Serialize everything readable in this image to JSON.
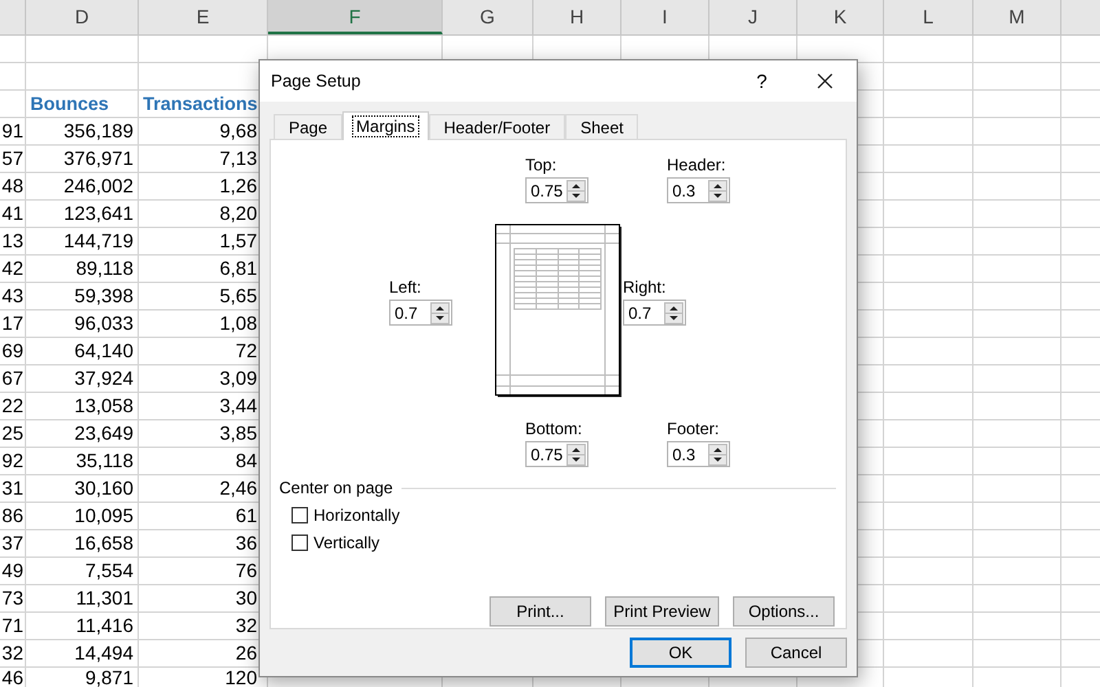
{
  "sheet": {
    "columns": [
      {
        "label": "D",
        "selected": false
      },
      {
        "label": "E",
        "selected": false
      },
      {
        "label": "F",
        "selected": true
      },
      {
        "label": "G",
        "selected": false
      },
      {
        "label": "H",
        "selected": false
      },
      {
        "label": "I",
        "selected": false
      },
      {
        "label": "J",
        "selected": false
      },
      {
        "label": "K",
        "selected": false
      },
      {
        "label": "L",
        "selected": false
      },
      {
        "label": "M",
        "selected": false
      }
    ],
    "header_row": {
      "bounces": "Bounces",
      "transactions": "Transactions"
    },
    "rows": [
      {
        "column_c": "91",
        "bounces": "356,189",
        "transactions": "9,68"
      },
      {
        "column_c": "57",
        "bounces": "376,971",
        "transactions": "7,13"
      },
      {
        "column_c": "48",
        "bounces": "246,002",
        "transactions": "1,26"
      },
      {
        "column_c": "41",
        "bounces": "123,641",
        "transactions": "8,20"
      },
      {
        "column_c": "13",
        "bounces": "144,719",
        "transactions": "1,57"
      },
      {
        "column_c": "42",
        "bounces": "89,118",
        "transactions": "6,81"
      },
      {
        "column_c": "43",
        "bounces": "59,398",
        "transactions": "5,65"
      },
      {
        "column_c": "17",
        "bounces": "96,033",
        "transactions": "1,08"
      },
      {
        "column_c": "69",
        "bounces": "64,140",
        "transactions": "72"
      },
      {
        "column_c": "67",
        "bounces": "37,924",
        "transactions": "3,09"
      },
      {
        "column_c": "22",
        "bounces": "13,058",
        "transactions": "3,44"
      },
      {
        "column_c": "25",
        "bounces": "23,649",
        "transactions": "3,85"
      },
      {
        "column_c": "92",
        "bounces": "35,118",
        "transactions": "84"
      },
      {
        "column_c": "31",
        "bounces": "30,160",
        "transactions": "2,46"
      },
      {
        "column_c": "86",
        "bounces": "10,095",
        "transactions": "61"
      },
      {
        "column_c": "37",
        "bounces": "16,658",
        "transactions": "36"
      },
      {
        "column_c": "49",
        "bounces": "7,554",
        "transactions": "76"
      },
      {
        "column_c": "73",
        "bounces": "11,301",
        "transactions": "30"
      },
      {
        "column_c": "71",
        "bounces": "11,416",
        "transactions": "32"
      },
      {
        "column_c": "32",
        "bounces": "14,494",
        "transactions": "26"
      },
      {
        "column_c": "46",
        "bounces": "9,871",
        "transactions": "120"
      }
    ]
  },
  "dialog": {
    "title": "Page Setup",
    "help": "?",
    "tabs": [
      {
        "label": "Page",
        "selected": false
      },
      {
        "label": "Margins",
        "selected": true
      },
      {
        "label": "Header/Footer",
        "selected": false
      },
      {
        "label": "Sheet",
        "selected": false
      }
    ],
    "margins": [
      {
        "kind": "top",
        "label": "Top:",
        "value": "0.75"
      },
      {
        "kind": "header",
        "label": "Header:",
        "value": "0.3"
      },
      {
        "kind": "left",
        "label": "Left:",
        "value": "0.7"
      },
      {
        "kind": "right",
        "label": "Right:",
        "value": "0.7"
      },
      {
        "kind": "bottom",
        "label": "Bottom:",
        "value": "0.75"
      },
      {
        "kind": "footer",
        "label": "Footer:",
        "value": "0.3"
      }
    ],
    "center_on_page": {
      "title": "Center on page",
      "options": [
        {
          "label": "Horizontally",
          "checked": false
        },
        {
          "label": "Vertically",
          "checked": false
        }
      ]
    },
    "buttons": [
      {
        "label": "Print..."
      },
      {
        "label": "Print Preview"
      },
      {
        "label": "Options..."
      }
    ],
    "footer_buttons": [
      {
        "label": "OK",
        "default": true
      },
      {
        "label": "Cancel",
        "default": false
      }
    ]
  }
}
